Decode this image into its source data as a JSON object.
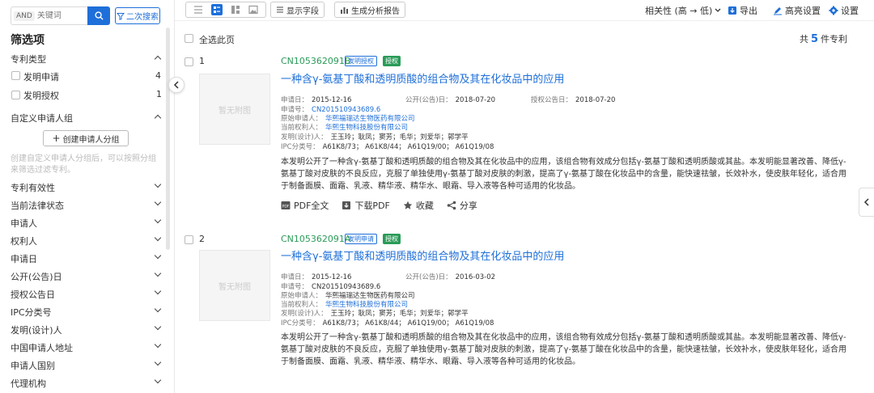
{
  "search": {
    "and_label": "AND",
    "placeholder": "关键词",
    "second_search_label": "二次搜索"
  },
  "sidebar": {
    "title": "筛选项",
    "patent_type": {
      "label": "专利类型",
      "options": [
        {
          "label": "发明申请",
          "count": "4"
        },
        {
          "label": "发明授权",
          "count": "1"
        }
      ]
    },
    "custom_group": {
      "label": "自定义申请人组",
      "create_button": "创建申请人分组",
      "hint": "创建自定义申请人分组后，可以按照分组来筛选过滤专利。"
    },
    "filters": [
      "专利有效性",
      "当前法律状态",
      "申请人",
      "权利人",
      "申请日",
      "公开(公告)日",
      "授权公告日",
      "IPC分类号",
      "发明(设计)人",
      "中国申请人地址",
      "申请人国别",
      "代理机构"
    ]
  },
  "toolbar": {
    "show_fields": "显示字段",
    "analysis_report": "生成分析报告",
    "sort": "相关性 (高 → 低)",
    "export": "导出",
    "highlight": "高亮设置",
    "settings": "设置"
  },
  "results": {
    "select_all": "全选此页",
    "total_prefix": "共",
    "total_count": "5",
    "total_suffix": "件专利"
  },
  "labels": {
    "app_date": "申请日：",
    "pub_date": "公开(公告)日：",
    "grant_date": "授权公告日：",
    "app_no": "申请号：",
    "orig_applicant": "原始申请人：",
    "current_owner": "当前权利人：",
    "inventors": "发明(设计)人：",
    "ipc": "IPC分类号："
  },
  "records": [
    {
      "num": "1",
      "pub_no": "CN105362091B",
      "tag1": "发明授权",
      "tag2": "授权",
      "title": "一种含γ-氨基丁酸和透明质酸的组合物及其在化妆品中的应用",
      "thumb": "暂无附图",
      "app_date": "2015-12-16",
      "pub_date": "2018-07-20",
      "grant_date": "2018-07-20",
      "app_no": "CN201510943689.6",
      "orig_applicant": "华熙福瑞达生物医药有限公司",
      "current_owner": "华熙生物科技股份有限公司",
      "inventors": "王玉玲；耿凤；窦芳；毛华；刘爱华；郭学平",
      "ipc": "A61K8/73； A61K8/44； A61Q19/00； A61Q19/08",
      "abstract": "本发明公开了一种含γ-氨基丁酸和透明质酸的组合物及其在化妆品中的应用，该组合物有效成分包括γ-氨基丁酸和透明质酸或其盐。本发明能显著改善、降低γ-氨基丁酸对皮肤的不良反应，克服了单独使用γ-氨基丁酸对皮肤的刺激，提高了γ-氨基丁酸在化妆品中的含量，能快速祛皱，长效补水，使皮肤年轻化，适合用于制备面膜、面霜、乳液、精华液、精华水、眼霜、导入液等各种可适用的化妆品。",
      "actions": [
        "PDF全文",
        "下载PDF",
        "收藏",
        "分享"
      ]
    },
    {
      "num": "2",
      "pub_no": "CN105362091A",
      "tag1": "发明申请",
      "tag2": "授权",
      "title": "一种含γ-氨基丁酸和透明质酸的组合物及其在化妆品中的应用",
      "thumb": "暂无附图",
      "app_date": "2015-12-16",
      "pub_date": "2016-03-02",
      "app_no": "CN201510943689.6",
      "orig_applicant": "华熙福瑞达生物医药有限公司",
      "current_owner": "华熙生物科技股份有限公司",
      "inventors": "王玉玲；耿凤；窦芳；毛华；刘爱华；郭学平",
      "ipc": "A61K8/73； A61K8/44； A61Q19/00； A61Q19/08",
      "abstract": "本发明公开了一种含γ-氨基丁酸和透明质酸的组合物及其在化妆品中的应用，该组合物有效成分包括γ-氨基丁酸和透明质酸或其盐。本发明能显著改善、降低γ-氨基丁酸对皮肤的不良反应，克服了单独使用γ-氨基丁酸对皮肤的刺激，提高了γ-氨基丁酸在化妆品中的含量，能快速祛皱，长效补水，使皮肤年轻化，适合用于制备面膜、面霜、乳液、精华液、精华水、眼霜、导入液等各种可适用的化妆品。"
    }
  ],
  "colors": {
    "accent": "#1e6fd9",
    "green": "#2a9b58"
  }
}
